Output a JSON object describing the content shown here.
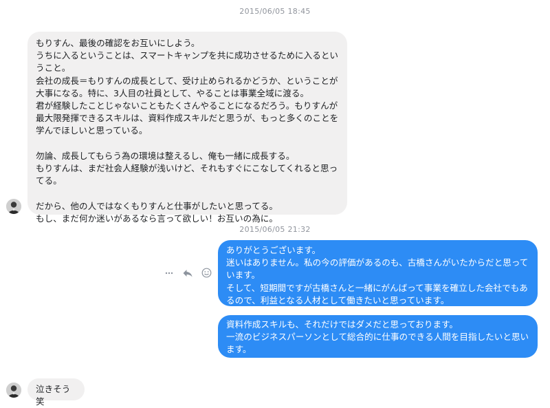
{
  "conversation": {
    "timestamps": [
      "2015/06/05 18:45",
      "2015/06/05 21:32"
    ],
    "messages": [
      {
        "direction": "incoming",
        "text": "もりすん、最後の確認をお互いにしよう。\nうちに入るということは、スマートキャンプを共に成功させるために入るとい\nうこと。\n会社の成長＝もりすんの成長として、受け止められるかどうか、ということが\n大事になる。特に、3人目の社員として、やることは事業全域に渡る。\n君が経験したことじゃないこともたくさんやることになるだろう。もりすんが\n最大限発揮できるスキルは、資料作成スキルだと思うが、もっと多くのことを\n学んでほしいと思っている。\n\n勿論、成長してもらう為の環境は整えるし、俺も一緒に成長する。\nもりすんは、まだ社会人経験が浅いけど、それもすぐにこなしてくれると思っ\nてる。\n\nだから、他の人ではなくもりすんと仕事がしたいと思ってる。\nもし、まだ何か迷いがあるなら言って欲しい！お互いの為に。"
      },
      {
        "direction": "outgoing",
        "text": "ありがとうございます。\n迷いはありません。私の今の評価があるのも、古橋さんがいたからだと思って\nいます。\nそして、短期間ですが古橋さんと一緒にがんばって事業を確立した会社でもあ\nるので、利益となる人材として働きたいと思っています。"
      },
      {
        "direction": "outgoing",
        "text": "資料作成スキルも、それだけではダメだと思っております。\n一流のビジネスパーソンとして総合的に仕事のできる人間を目指したいと思い\nます。"
      },
      {
        "direction": "incoming",
        "text": "泣きそう笑"
      }
    ]
  },
  "actions": {
    "more_icon": "more-horizontal-icon",
    "reply_icon": "reply-arrow-icon",
    "react_icon": "smiley-reaction-icon"
  },
  "colors": {
    "incoming_bubble": "#f1f0f0",
    "outgoing_bubble": "#2d8cf5",
    "timestamp_text": "#90949c"
  }
}
